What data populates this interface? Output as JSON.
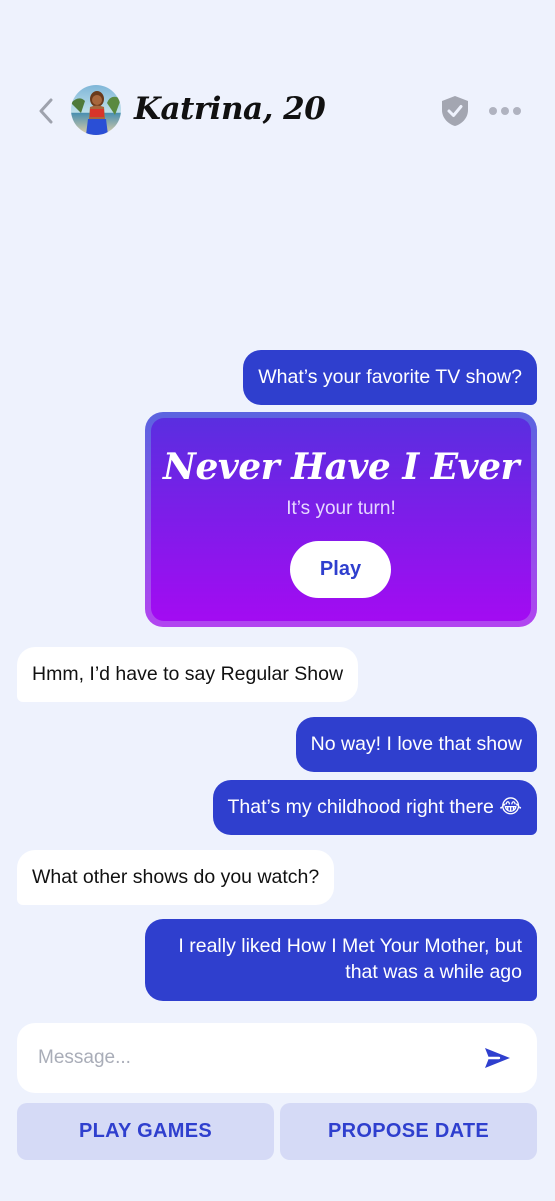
{
  "header": {
    "name": "Katrina, 20"
  },
  "messages": [
    {
      "from": "me",
      "text": "What’s your favorite TV show?"
    },
    {
      "from": "them",
      "text": "Hmm, I’d have to say Regular Show"
    },
    {
      "from": "me",
      "text": "No way! I love that show"
    },
    {
      "from": "me",
      "text": "That’s my childhood right there 😂"
    },
    {
      "from": "them",
      "text": "What other shows do you watch?"
    },
    {
      "from": "me",
      "text": "I really liked How I Met Your Mother, but that was a while ago"
    }
  ],
  "game_card": {
    "title": "Never Have I Ever",
    "subtitle": "It’s your turn!",
    "play_label": "Play"
  },
  "composer": {
    "placeholder": "Message..."
  },
  "actions": {
    "play_games": "PLAY GAMES",
    "propose_date": "PROPOSE DATE"
  },
  "colors": {
    "accent": "#2f3fce",
    "background": "#eef2fd",
    "game_gradient_top": "#5a2ee0",
    "game_gradient_bottom": "#a30bf2"
  }
}
